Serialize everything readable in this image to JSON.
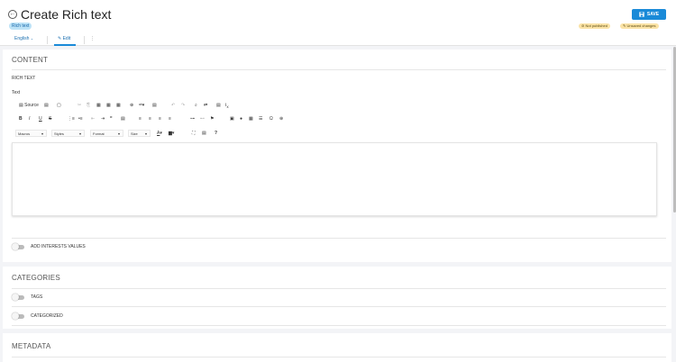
{
  "header": {
    "back_icon": "arrow-left-circle-icon",
    "title": "Create Rich text",
    "type_badge": "Rich text",
    "save_label": "SAVE",
    "status": {
      "not_published": "Not published",
      "unsaved": "Unsaved changes"
    }
  },
  "tabs": {
    "language": "English",
    "edit": "Edit",
    "more": "⋮"
  },
  "content": {
    "title": "CONTENT",
    "rich_text_label": "RICH TEXT",
    "text_label": "Text",
    "toolbar": {
      "source": "Source",
      "macros": "Macros",
      "styles": "Styles",
      "format": "Format",
      "size": "Size"
    },
    "add_interests_label": "ADD INTERESTS VALUES"
  },
  "categories": {
    "title": "CATEGORIES",
    "tags_label": "TAGS",
    "categorized_label": "CATEGORIZED"
  },
  "metadata": {
    "title": "METADATA"
  },
  "colors": {
    "accent": "#1a8ad8",
    "badge_bg": "#bde3f7",
    "status_bg": "#fbe3a6"
  }
}
